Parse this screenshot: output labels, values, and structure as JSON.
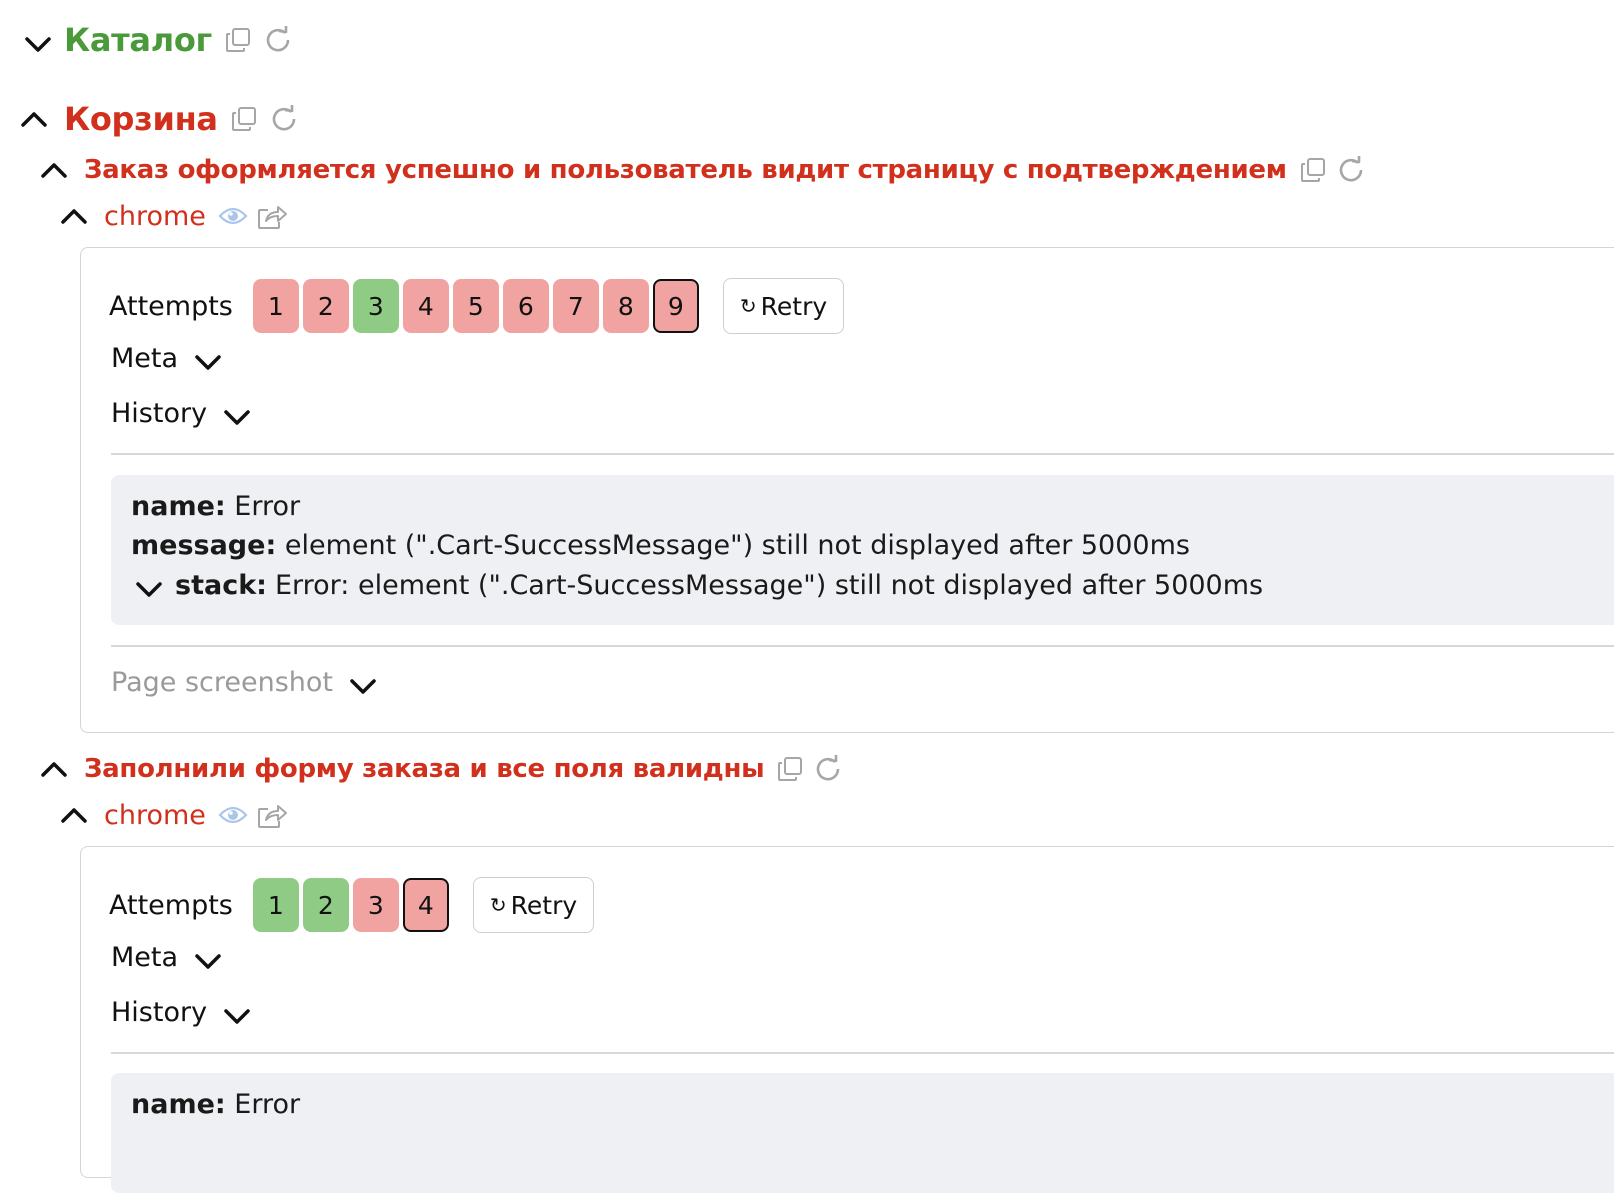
{
  "colors": {
    "passed_title": "#4a9a3c",
    "failed_title": "#d1301c",
    "attempt_failed": "#f0a3a0",
    "attempt_passed": "#8fcb84",
    "icon_gray": "#a6a6a6",
    "eye_blue": "#a9c6ea"
  },
  "suites": [
    {
      "title": "Каталог",
      "status": "passed",
      "expanded": false
    },
    {
      "title": "Корзина",
      "status": "failed",
      "expanded": true
    }
  ],
  "tests": [
    {
      "title": "Заказ оформляется успешно и пользователь видит страницу с подтверждением",
      "browser": "chrome",
      "attempts_label": "Attempts",
      "attempts": [
        {
          "n": "1",
          "status": "failed"
        },
        {
          "n": "2",
          "status": "failed"
        },
        {
          "n": "3",
          "status": "passed"
        },
        {
          "n": "4",
          "status": "failed"
        },
        {
          "n": "5",
          "status": "failed"
        },
        {
          "n": "6",
          "status": "failed"
        },
        {
          "n": "7",
          "status": "failed"
        },
        {
          "n": "8",
          "status": "failed"
        },
        {
          "n": "9",
          "status": "failed",
          "selected": true
        }
      ],
      "retry_label": "Retry",
      "meta_label": "Meta",
      "history_label": "History",
      "error": {
        "name_key": "name:",
        "name_value": "Error",
        "message_key": "message:",
        "message_value": "element (\".Cart-SuccessMessage\") still not displayed after 5000ms",
        "stack_key": "stack:",
        "stack_value": "Error: element (\".Cart-SuccessMessage\") still not displayed after 5000ms"
      },
      "screenshot_label": "Page screenshot"
    },
    {
      "title": "Заполнили форму заказа и все поля валидны",
      "browser": "chrome",
      "attempts_label": "Attempts",
      "attempts": [
        {
          "n": "1",
          "status": "passed"
        },
        {
          "n": "2",
          "status": "passed"
        },
        {
          "n": "3",
          "status": "failed"
        },
        {
          "n": "4",
          "status": "failed",
          "selected": true
        }
      ],
      "retry_label": "Retry",
      "meta_label": "Meta",
      "history_label": "History",
      "error": {
        "name_key": "name:",
        "name_value": "Error"
      }
    }
  ]
}
